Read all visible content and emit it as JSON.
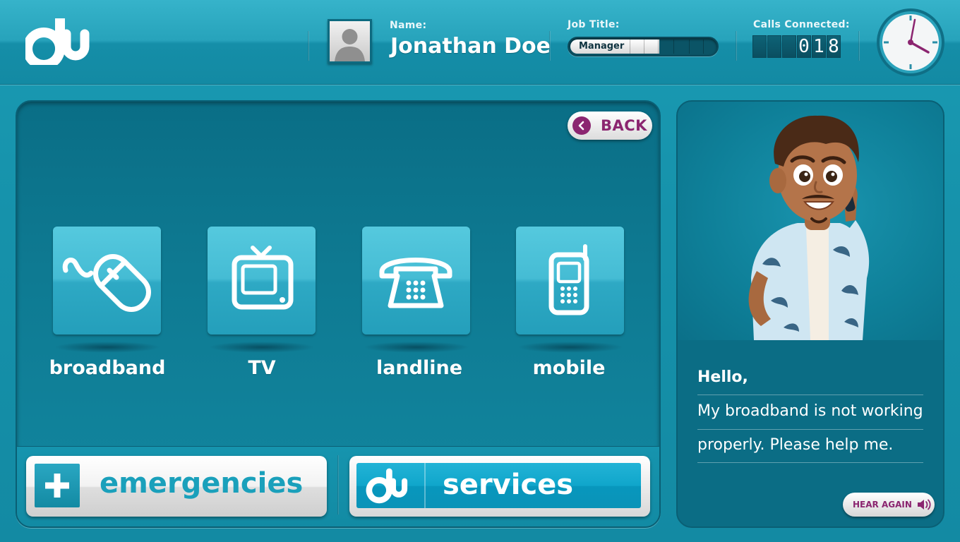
{
  "header": {
    "logo": "du",
    "name_label": "Name:",
    "name_value": "Jonathan Doe",
    "job_label": "Job Title:",
    "job_value": "Manager",
    "job_progress_segments_filled": 5,
    "job_progress_segments_total": 9,
    "calls_label": "Calls Connected:",
    "calls_digits": [
      "",
      "",
      "",
      "0",
      "1",
      "8"
    ]
  },
  "main": {
    "back_label": "BACK",
    "tiles": [
      {
        "label": "broadband",
        "icon": "mouse-icon"
      },
      {
        "label": "TV",
        "icon": "tv-icon"
      },
      {
        "label": "landline",
        "icon": "telephone-icon"
      },
      {
        "label": "mobile",
        "icon": "mobile-phone-icon"
      }
    ],
    "emergencies_label": "emergencies",
    "services_label": "services"
  },
  "side": {
    "greeting": "Hello,",
    "message_line_1": "My broadband is not working",
    "message_line_2": "properly. Please help me.",
    "hear_again_label": "HEAR AGAIN"
  },
  "colors": {
    "accent": "#8b2570",
    "background": "#138aa3",
    "tile": "#45bcd4"
  }
}
